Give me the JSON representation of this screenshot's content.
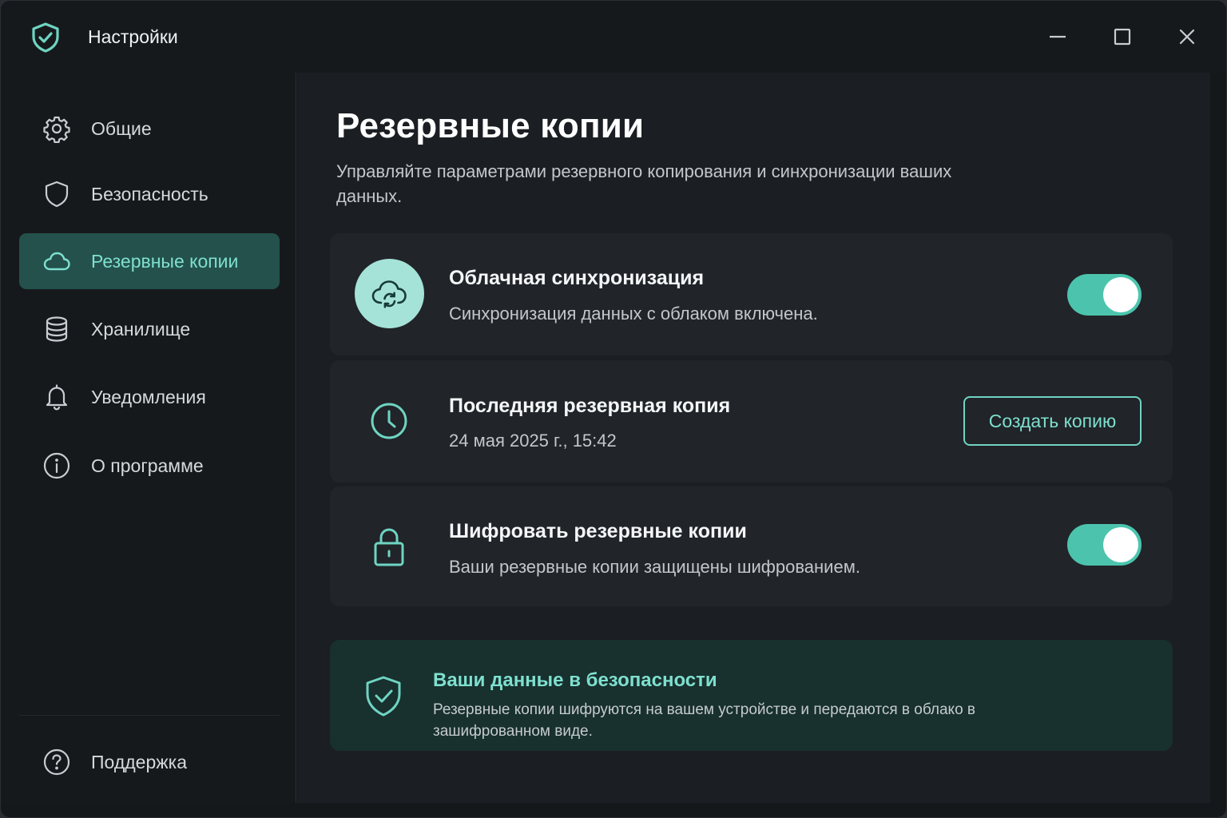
{
  "window": {
    "title": "Настройки",
    "controls": {
      "minimize": "minimize-icon",
      "maximize": "maximize-icon",
      "close": "close-icon"
    }
  },
  "sidebar": {
    "items": [
      {
        "label": "Общие",
        "icon": "gear-icon",
        "active": false
      },
      {
        "label": "Безопасность",
        "icon": "shield-icon",
        "active": false
      },
      {
        "label": "Резервные копии",
        "icon": "cloud-icon",
        "active": true
      },
      {
        "label": "Хранилище",
        "icon": "database-icon",
        "active": false
      },
      {
        "label": "Уведомления",
        "icon": "bell-icon",
        "active": false
      },
      {
        "label": "О программе",
        "icon": "info-icon",
        "active": false
      }
    ],
    "support": {
      "label": "Поддержка",
      "icon": "help-icon"
    }
  },
  "main": {
    "title": "Резервные копии",
    "subtitle": "Управляйте параметрами резервного копирования и синхронизации ваших данных.",
    "cards": {
      "cloud_sync": {
        "title": "Облачная синхронизация",
        "description": "Синхронизация данных с облаком включена.",
        "enabled": true,
        "icon": "cloud-sync-icon"
      },
      "last_backup": {
        "title": "Последняя резервная копия",
        "timestamp": "24 мая 2025 г., 15:42",
        "button_label": "Создать копию",
        "icon": "clock-icon"
      },
      "encryption": {
        "title": "Шифровать резервные копии",
        "description": "Ваши резервные копии защищены шифрованием.",
        "enabled": true,
        "icon": "lock-icon"
      }
    },
    "notice": {
      "title": "Ваши данные в безопасности",
      "text": "Резервные копии шифруются на вашем устройстве и передаются в облако в зашифрованном виде.",
      "icon": "shield-check-icon"
    }
  },
  "colors": {
    "accent": "#4cc4ad",
    "accent_text": "#7ee0cf",
    "active_nav_bg": "#24514c",
    "card_bg": "#212429",
    "notice_bg": "#18302e",
    "window_bg": "#15181b"
  }
}
